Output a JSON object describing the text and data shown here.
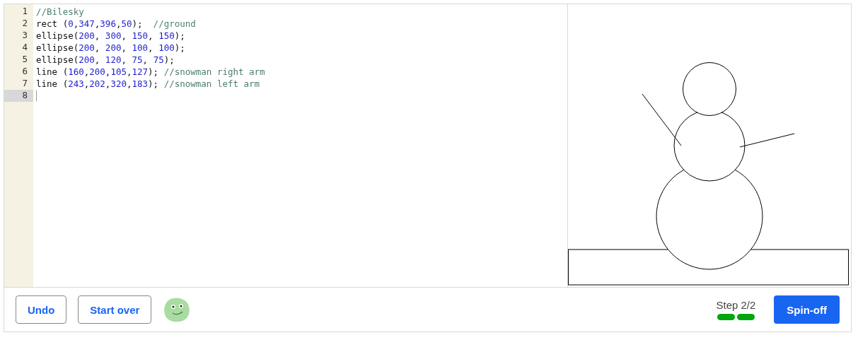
{
  "editor": {
    "lines": [
      {
        "number": "1",
        "active": false,
        "tokens": [
          {
            "kind": "comment",
            "text": "//Bilesky"
          }
        ]
      },
      {
        "number": "2",
        "active": false,
        "tokens": [
          {
            "kind": "plain",
            "text": "rect ("
          },
          {
            "kind": "number",
            "text": "0"
          },
          {
            "kind": "plain",
            "text": ","
          },
          {
            "kind": "number",
            "text": "347"
          },
          {
            "kind": "plain",
            "text": ","
          },
          {
            "kind": "number",
            "text": "396"
          },
          {
            "kind": "plain",
            "text": ","
          },
          {
            "kind": "number",
            "text": "50"
          },
          {
            "kind": "plain",
            "text": ");  "
          },
          {
            "kind": "comment",
            "text": "//ground"
          }
        ]
      },
      {
        "number": "3",
        "active": false,
        "tokens": [
          {
            "kind": "plain",
            "text": "ellipse("
          },
          {
            "kind": "number",
            "text": "200"
          },
          {
            "kind": "plain",
            "text": ", "
          },
          {
            "kind": "number",
            "text": "300"
          },
          {
            "kind": "plain",
            "text": ", "
          },
          {
            "kind": "number",
            "text": "150"
          },
          {
            "kind": "plain",
            "text": ", "
          },
          {
            "kind": "number",
            "text": "150"
          },
          {
            "kind": "plain",
            "text": ");"
          }
        ]
      },
      {
        "number": "4",
        "active": false,
        "tokens": [
          {
            "kind": "plain",
            "text": "ellipse("
          },
          {
            "kind": "number",
            "text": "200"
          },
          {
            "kind": "plain",
            "text": ", "
          },
          {
            "kind": "number",
            "text": "200"
          },
          {
            "kind": "plain",
            "text": ", "
          },
          {
            "kind": "number",
            "text": "100"
          },
          {
            "kind": "plain",
            "text": ", "
          },
          {
            "kind": "number",
            "text": "100"
          },
          {
            "kind": "plain",
            "text": ");"
          }
        ]
      },
      {
        "number": "5",
        "active": false,
        "tokens": [
          {
            "kind": "plain",
            "text": "ellipse("
          },
          {
            "kind": "number",
            "text": "200"
          },
          {
            "kind": "plain",
            "text": ", "
          },
          {
            "kind": "number",
            "text": "120"
          },
          {
            "kind": "plain",
            "text": ", "
          },
          {
            "kind": "number",
            "text": "75"
          },
          {
            "kind": "plain",
            "text": ", "
          },
          {
            "kind": "number",
            "text": "75"
          },
          {
            "kind": "plain",
            "text": ");"
          }
        ]
      },
      {
        "number": "6",
        "active": false,
        "tokens": [
          {
            "kind": "plain",
            "text": "line ("
          },
          {
            "kind": "number",
            "text": "160"
          },
          {
            "kind": "plain",
            "text": ","
          },
          {
            "kind": "number",
            "text": "200"
          },
          {
            "kind": "plain",
            "text": ","
          },
          {
            "kind": "number",
            "text": "105"
          },
          {
            "kind": "plain",
            "text": ","
          },
          {
            "kind": "number",
            "text": "127"
          },
          {
            "kind": "plain",
            "text": "); "
          },
          {
            "kind": "comment",
            "text": "//snowman right arm"
          }
        ]
      },
      {
        "number": "7",
        "active": false,
        "tokens": [
          {
            "kind": "plain",
            "text": "line ("
          },
          {
            "kind": "number",
            "text": "243"
          },
          {
            "kind": "plain",
            "text": ","
          },
          {
            "kind": "number",
            "text": "202"
          },
          {
            "kind": "plain",
            "text": ","
          },
          {
            "kind": "number",
            "text": "320"
          },
          {
            "kind": "plain",
            "text": ","
          },
          {
            "kind": "number",
            "text": "183"
          },
          {
            "kind": "plain",
            "text": "); "
          },
          {
            "kind": "comment",
            "text": "//snowman left arm"
          }
        ]
      },
      {
        "number": "8",
        "active": true
      }
    ]
  },
  "footer": {
    "buttons": [
      "Undo",
      "Start over"
    ],
    "step": "Step 2/2",
    "progress": [
      {
        "done": true
      },
      {
        "done": true
      }
    ],
    "spinoff": "Spin-off"
  }
}
